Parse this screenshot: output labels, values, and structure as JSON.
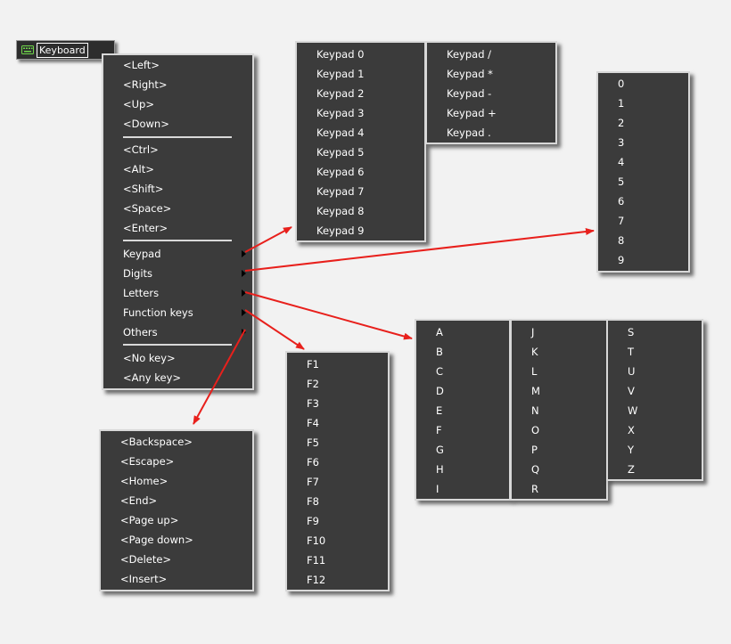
{
  "trigger": {
    "label": "Keyboard",
    "icon": "keyboard-icon",
    "icon_color": "#6fd64a"
  },
  "main_menu": {
    "group1": [
      "<Left>",
      "<Right>",
      "<Up>",
      "<Down>"
    ],
    "group2": [
      "<Ctrl>",
      "<Alt>",
      "<Shift>",
      "<Space>",
      "<Enter>"
    ],
    "submenus": [
      "Keypad",
      "Digits",
      "Letters",
      "Function keys",
      "Others"
    ],
    "group4": [
      "<No key>",
      "<Any key>"
    ]
  },
  "keypad_menu": {
    "col1": [
      "Keypad 0",
      "Keypad 1",
      "Keypad 2",
      "Keypad 3",
      "Keypad 4",
      "Keypad 5",
      "Keypad 6",
      "Keypad 7",
      "Keypad 8",
      "Keypad 9"
    ],
    "col2": [
      "Keypad /",
      "Keypad *",
      "Keypad -",
      "Keypad +",
      "Keypad ."
    ]
  },
  "digits_menu": {
    "items": [
      "0",
      "1",
      "2",
      "3",
      "4",
      "5",
      "6",
      "7",
      "8",
      "9"
    ]
  },
  "letters_menu": {
    "col1": [
      "A",
      "B",
      "C",
      "D",
      "E",
      "F",
      "G",
      "H",
      "I"
    ],
    "col2": [
      "J",
      "K",
      "L",
      "M",
      "N",
      "O",
      "P",
      "Q",
      "R"
    ],
    "col3": [
      "S",
      "T",
      "U",
      "V",
      "W",
      "X",
      "Y",
      "Z"
    ]
  },
  "function_menu": {
    "items": [
      "F1",
      "F2",
      "F3",
      "F4",
      "F5",
      "F6",
      "F7",
      "F8",
      "F9",
      "F10",
      "F11",
      "F12"
    ]
  },
  "others_menu": {
    "items": [
      "<Backspace>",
      "<Escape>",
      "<Home>",
      "<End>",
      "<Page up>",
      "<Page down>",
      "<Delete>",
      "<Insert>"
    ]
  },
  "colors": {
    "menu_bg": "#3b3b3b",
    "menu_border": "#d8d8d8",
    "arrow": "#e8201c",
    "text": "#ffffff"
  }
}
